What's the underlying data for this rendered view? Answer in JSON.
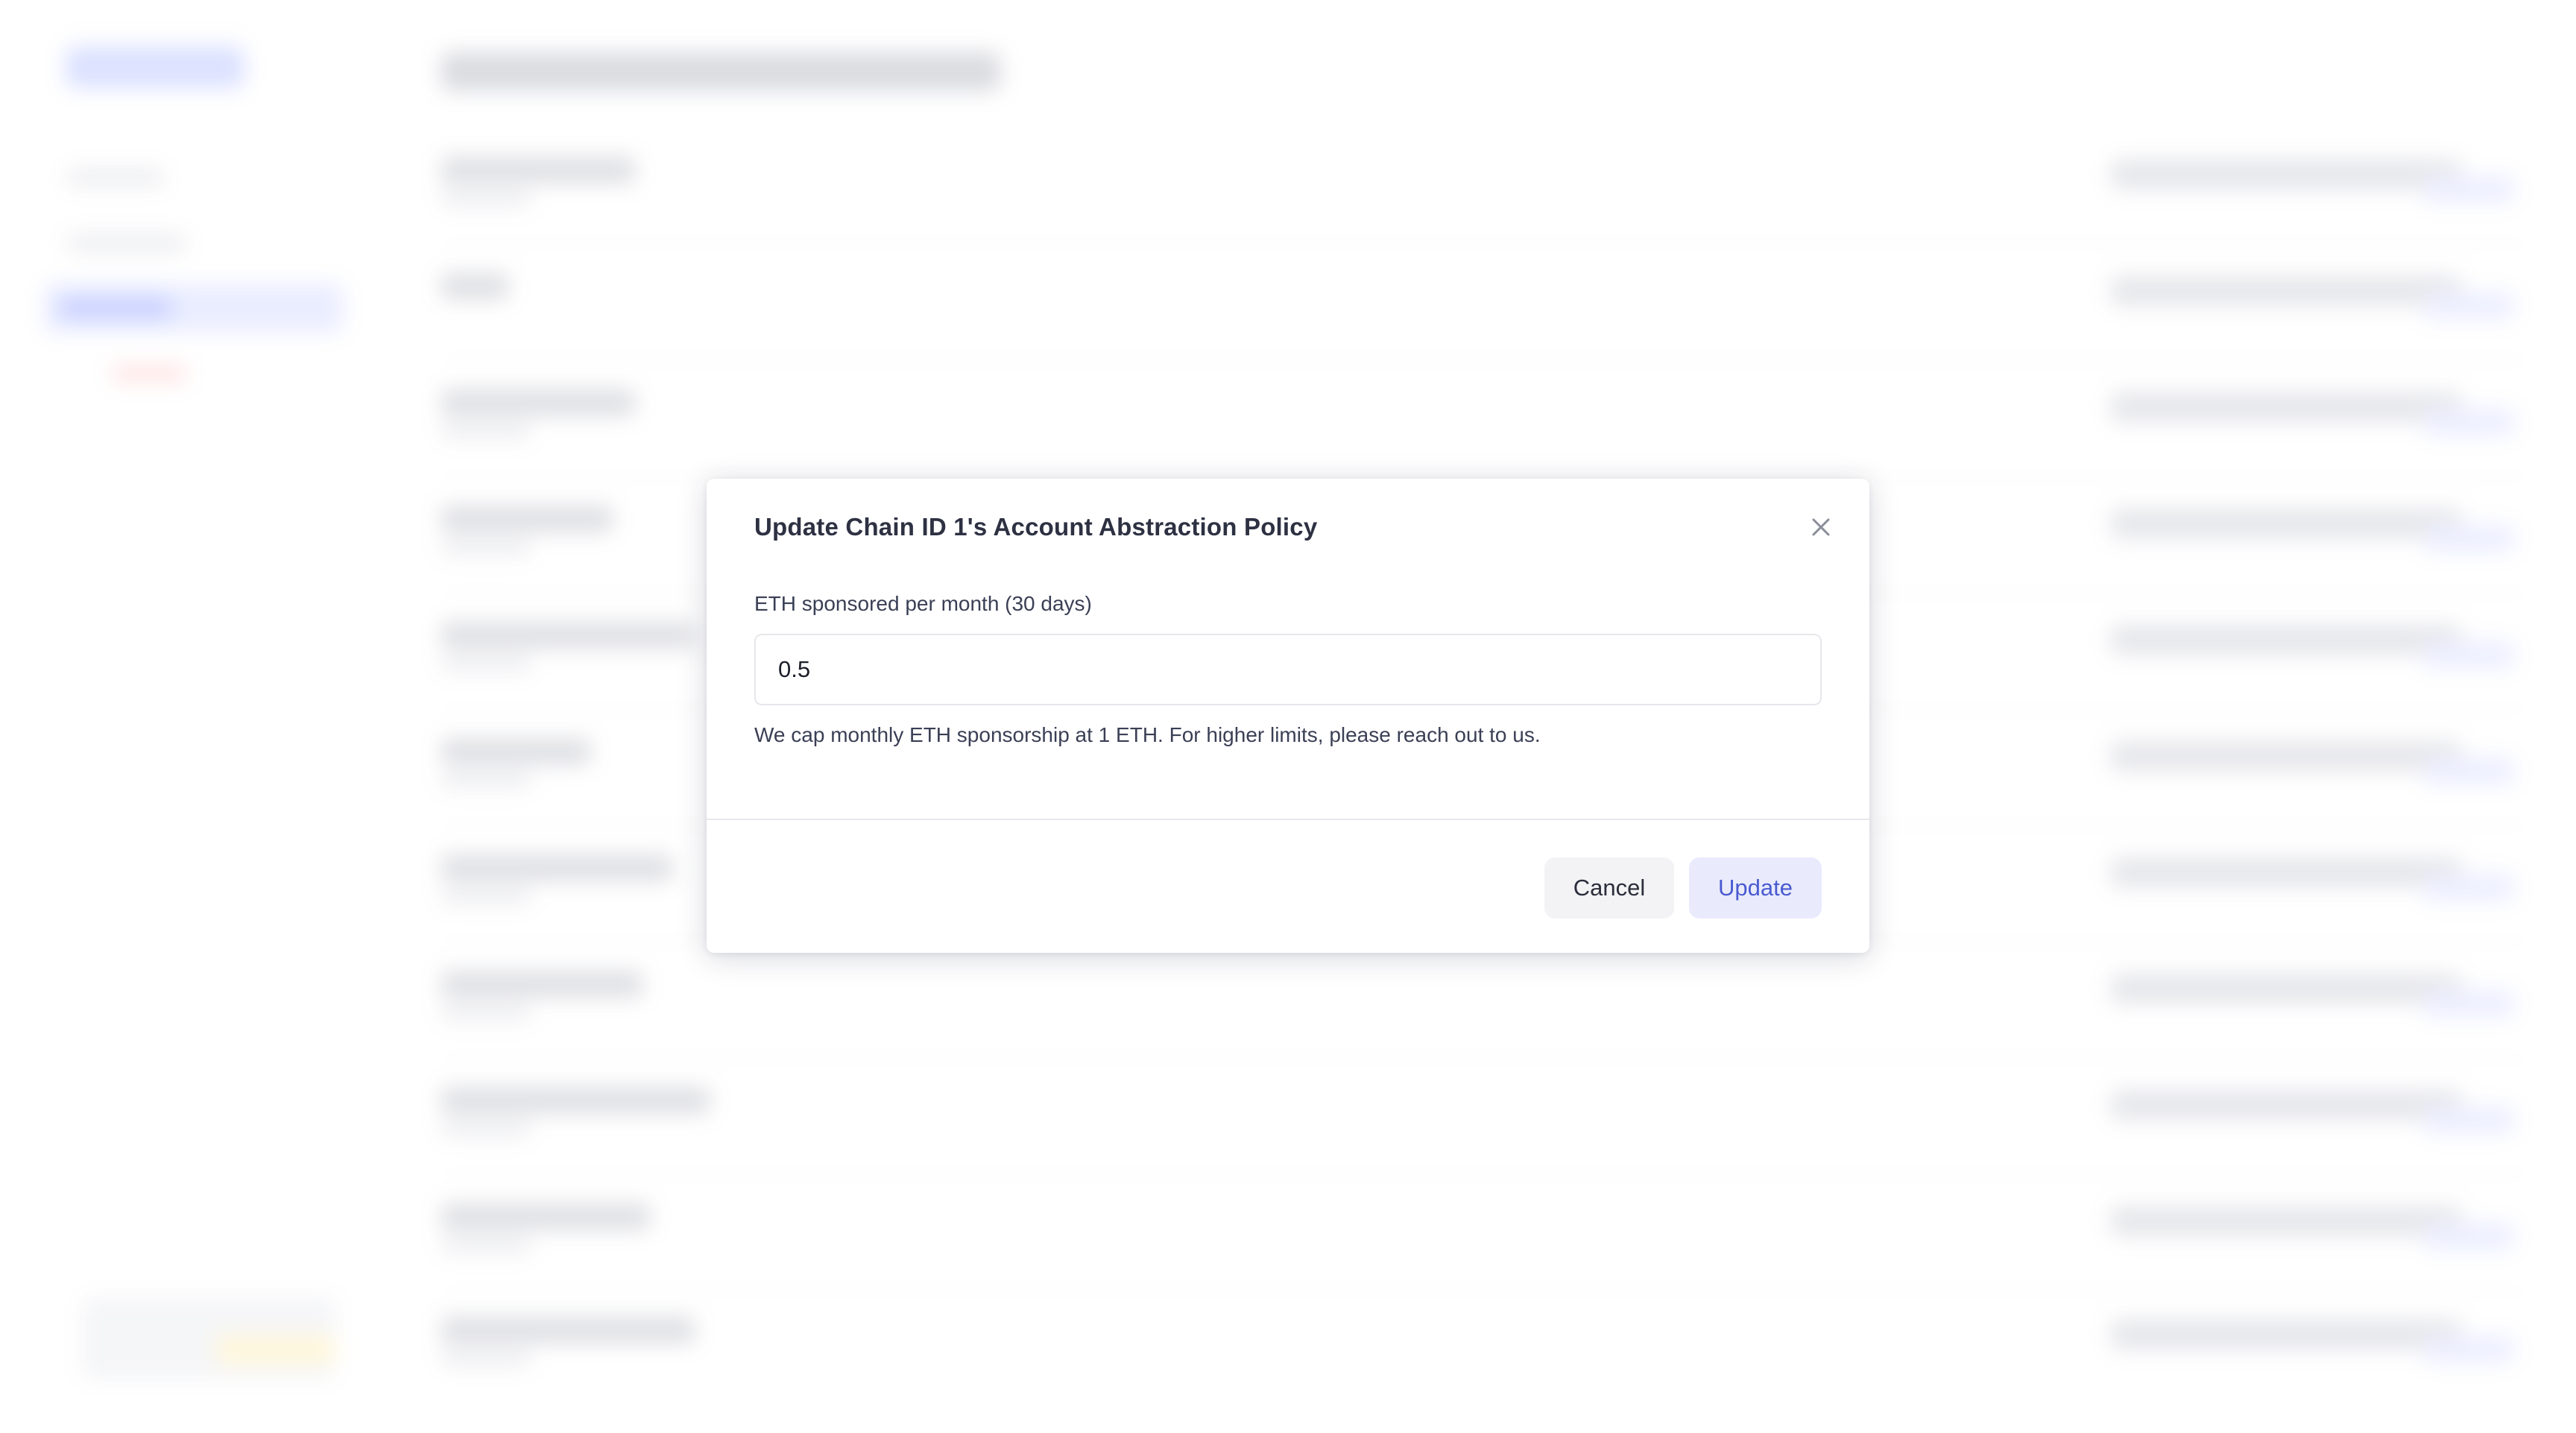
{
  "modal": {
    "title": "Update Chain ID 1's Account Abstraction Policy",
    "close_icon": "close-icon",
    "field_label": "ETH sponsored per month (30 days)",
    "field_value": "0.5",
    "help_text": "We cap monthly ETH sponsorship at 1 ETH. For higher limits, please reach out to us.",
    "cancel_label": "Cancel",
    "update_label": "Update"
  },
  "colors": {
    "title": "#2d3142",
    "primary_button_bg": "#e9ebfd",
    "primary_button_text": "#4a5bd0",
    "secondary_button_bg": "#f3f3f5"
  }
}
